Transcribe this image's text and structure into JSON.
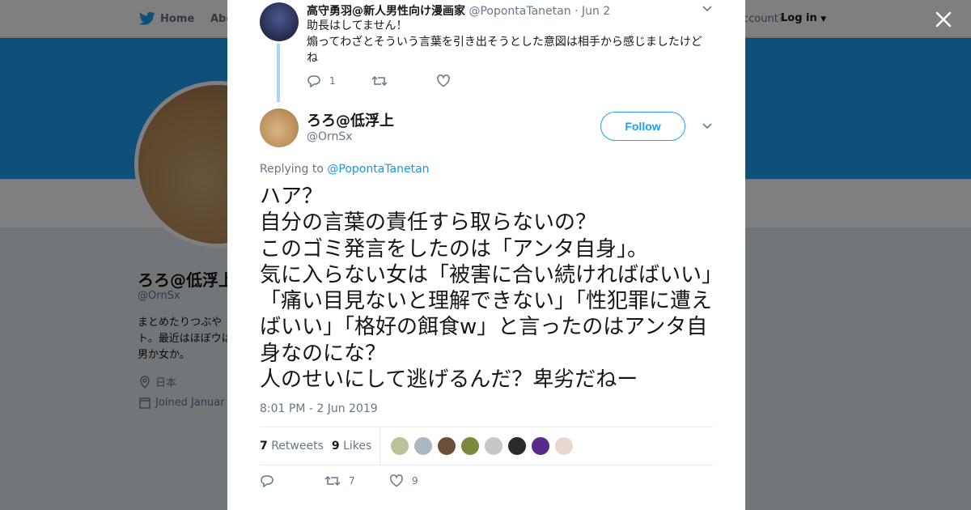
{
  "background": {
    "nav": {
      "home_label": "Home",
      "about_label": "Abo",
      "account_prompt": "ccount?",
      "login_label": "Log in"
    },
    "profile": {
      "name": "ろろ@低浮上",
      "handle": "@OrnSx",
      "bio": "まとめたりつぶやト。最近はほぼウは男か女か。",
      "location": "日本",
      "joined": "Joined Januar"
    }
  },
  "parent_tweet": {
    "name": "高守勇羽@新人男性向け漫画家",
    "handle": "@PopontaTanetan",
    "separator": "·",
    "date": "Jun 2",
    "text": "助長はしてません！\n煽ってわざとそういう言葉を引き出そうとした意図は相手から感じましたけどね",
    "reply_count": "1"
  },
  "tweet": {
    "author_name": "ろろ@低浮上",
    "author_handle": "@OrnSx",
    "follow_label": "Follow",
    "replying_prefix": "Replying to",
    "replying_to": "@PopontaTanetan",
    "text": "ハア？\n自分の言葉の責任すら取らないの？\nこのゴミ発言をしたのは「アンタ自身」。\n気に入らない女は「被害に合い続ければばいい」「痛い目見ないと理解できない」「性犯罪に遭えばいい」「格好の餌食w」と言ったのはアンタ自身なのにな？\n人のせいにして逃げるんだ？卑劣だねー",
    "timestamp": "8:01 PM - 2 Jun 2019",
    "retweets_count": "7",
    "retweets_label": "Retweets",
    "likes_count": "9",
    "likes_label": "Likes",
    "retweet_action_count": "7",
    "like_action_count": "9",
    "liker_avatar_colors": [
      "#b9c39a",
      "#aab8c2",
      "#6b4f3a",
      "#7a8a3c",
      "#c7c7c7",
      "#2a2a2a",
      "#5a2a8a",
      "#e8d8d0"
    ]
  },
  "colors": {
    "accent": "#1da1f2",
    "link": "#1b95e0",
    "thread_line": "#a9d6f5",
    "text": "#14171a",
    "muted": "#657786"
  },
  "icons": {
    "logo": "twitter-bird-icon",
    "close": "close-icon",
    "reply": "reply-icon",
    "retweet": "retweet-icon",
    "like": "heart-icon",
    "caret": "chevron-down-icon"
  }
}
